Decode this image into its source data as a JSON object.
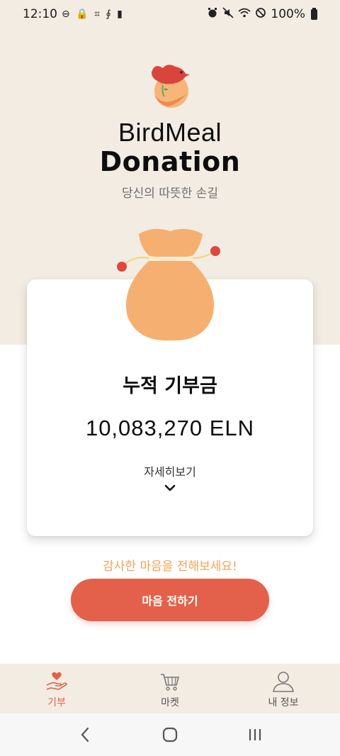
{
  "status_bar": {
    "time": "12:10",
    "left_icons": "⊖ 🔒 ⌗ ∮ ▮",
    "battery_text": "100%",
    "icons": [
      "alarm-icon",
      "mute-icon",
      "wifi-icon",
      "do-not-disturb-icon",
      "battery-icon"
    ]
  },
  "header": {
    "brand_line1": "BirdMeal",
    "brand_line2": "Donation",
    "tagline": "당신의 따뜻한 손길"
  },
  "card": {
    "title": "누적 기부금",
    "amount": "10,083,270 ELN",
    "more_label": "자세히보기"
  },
  "cta": {
    "message": "감사한 마음을 전해보세요!",
    "button_label": "마음 전하기"
  },
  "bottom_nav": {
    "items": [
      {
        "label": "기부",
        "icon": "donate-icon",
        "active": true
      },
      {
        "label": "마켓",
        "icon": "cart-icon",
        "active": false
      },
      {
        "label": "내 정보",
        "icon": "user-icon",
        "active": false
      }
    ]
  },
  "colors": {
    "background_top": "#f2ece2",
    "accent": "#e3614a",
    "highlight_text": "#f0a45a",
    "bag": "#f5b071"
  }
}
